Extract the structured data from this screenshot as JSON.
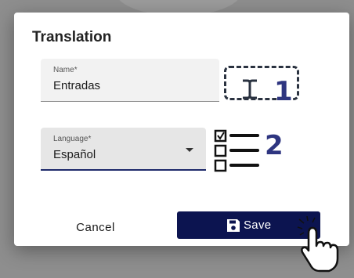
{
  "dialog": {
    "title": "Translation",
    "name_field": {
      "label": "Name",
      "required_mark": "*",
      "value": "Entradas"
    },
    "language_field": {
      "label": "Language",
      "required_mark": "*",
      "value": "Español"
    },
    "buttons": {
      "cancel_label": "Cancel",
      "save_label": "Save"
    }
  },
  "callouts": {
    "first": "1",
    "second": "2"
  },
  "colors": {
    "primary": "#0c1450",
    "callout_number": "#2e3580",
    "overlay": "#8e8e8e",
    "dialog": "#ffffff"
  },
  "icons": [
    "text-cursor-icon",
    "checklist-icon",
    "save-disk-icon",
    "pointer-hand-icon",
    "chevron-down-icon"
  ]
}
